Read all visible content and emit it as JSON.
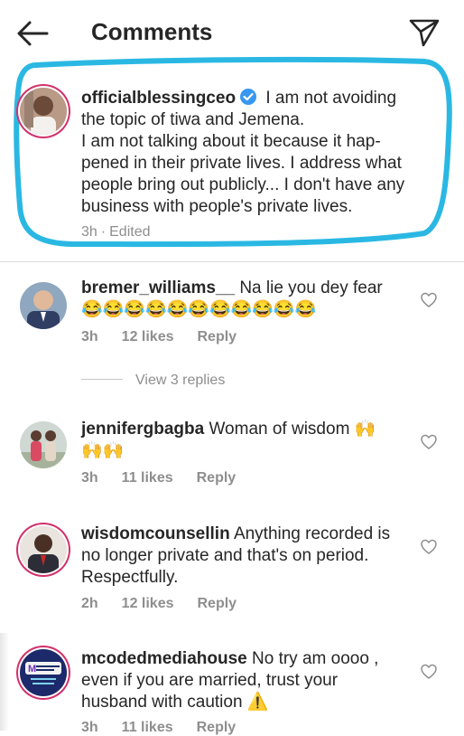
{
  "header": {
    "title": "Comments",
    "back_icon": "back-arrow-icon",
    "send_icon": "send-icon"
  },
  "caption": {
    "username": "officialblessingceo",
    "verified": true,
    "text_lines": [
      "I am not avoiding",
      "the topic of tiwa and Jemena.",
      "I am not talking about it because it hap-",
      "pened in their private lives. I address what",
      "people bring out publicly... I don't have any",
      "business with people's private lives."
    ],
    "time": "3h",
    "separator": "·",
    "edited": "Edited"
  },
  "comments": [
    {
      "username": "bremer_williams__",
      "text_lines": [
        "Na lie  you dey fear",
        "😂😂😂😂😂😂😂😂😂😂😂"
      ],
      "time": "3h",
      "likes": "12 likes",
      "reply": "Reply",
      "view_replies": "View 3 replies"
    },
    {
      "username": "jennifergbagba",
      "text_lines": [
        "Woman of wisdom 🙌",
        "🙌🙌"
      ],
      "time": "3h",
      "likes": "11 likes",
      "reply": "Reply"
    },
    {
      "username": "wisdomcounsellin",
      "text_lines": [
        "Anything recorded is",
        "no longer private and that's on period.",
        "Respectfully."
      ],
      "time": "2h",
      "likes": "12 likes",
      "reply": "Reply"
    },
    {
      "username": "mcodedmediahouse",
      "text_lines": [
        "No try am oooo ,",
        "even if you are married, trust your",
        "husband with caution ⚠️"
      ],
      "time": "3h",
      "likes": "11 likes",
      "reply": "Reply"
    }
  ],
  "colors": {
    "highlight": "#2ab8e3",
    "story_ring": "#d3306b",
    "verified": "#3897f0",
    "muted": "#8e8e8e"
  }
}
